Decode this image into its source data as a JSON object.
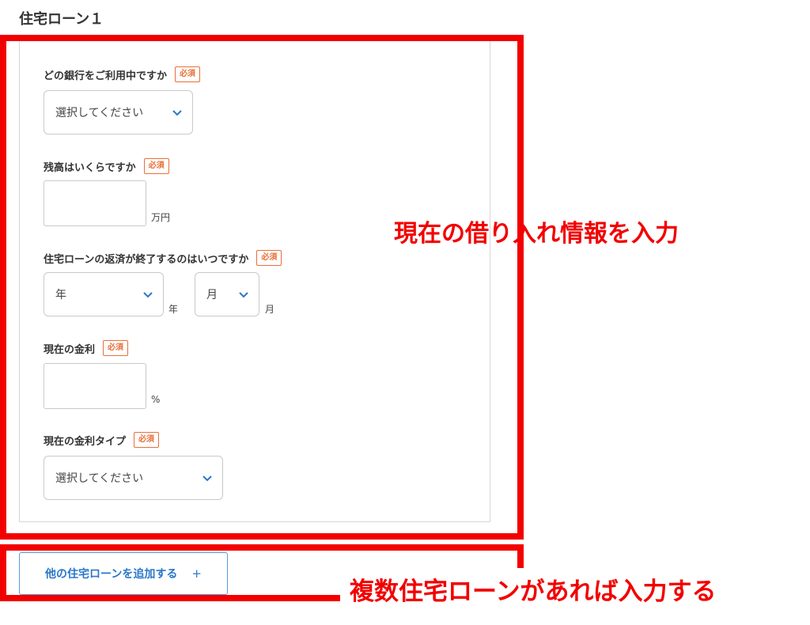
{
  "section_title": "住宅ローン１",
  "required_badge": "必須",
  "fields": {
    "bank": {
      "label": "どの銀行をご利用中ですか",
      "value": "選択してください"
    },
    "balance": {
      "label": "残高はいくらですか",
      "value": "",
      "unit": "万円"
    },
    "end_date": {
      "label": "住宅ローンの返済が終了するのはいつですか",
      "year_value": "年",
      "year_unit": "年",
      "month_value": "月",
      "month_unit": "月"
    },
    "rate": {
      "label": "現在の金利",
      "value": "",
      "unit": "%"
    },
    "rate_type": {
      "label": "現在の金利タイプ",
      "value": "選択してください"
    }
  },
  "add_button": {
    "label": "他の住宅ローンを追加する",
    "icon": "plus-icon",
    "symbol": "+"
  },
  "annotations": {
    "current_info": "現在の借り入れ情報を入力",
    "multiple_loans": "複数住宅ローンがあれば入力する"
  },
  "colors": {
    "accent_blue": "#2a77c9",
    "badge_orange": "#e8703a",
    "annotation_red": "#f20000"
  }
}
